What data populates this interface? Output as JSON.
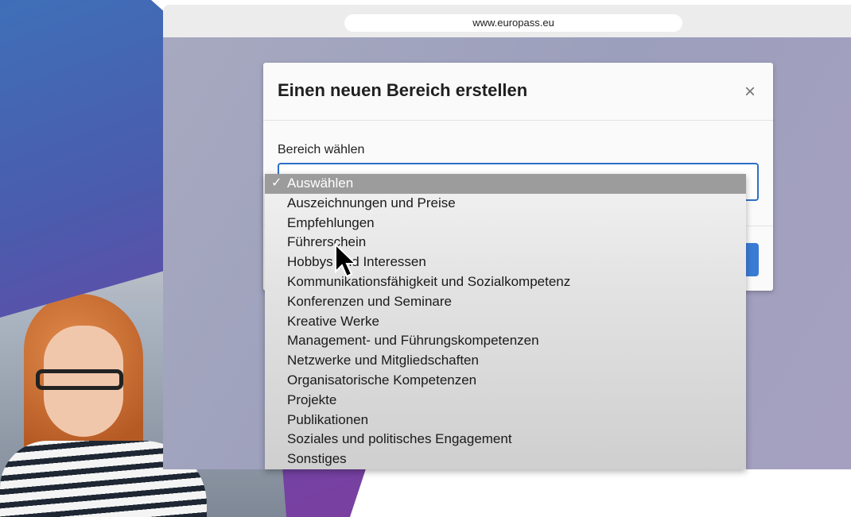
{
  "browser": {
    "url": "www.europass.eu"
  },
  "modal": {
    "title": "Einen neuen Bereich erstellen",
    "close_icon": "close-icon",
    "field_label": "Bereich wählen"
  },
  "dropdown": {
    "selected_check": "✓",
    "options": [
      "Auswählen",
      "Auszeichnungen und Preise",
      "Empfehlungen",
      "Führerschein",
      "Hobbys und Interessen",
      "Kommunikationsfähigkeit und Sozialkompetenz",
      "Konferenzen und Seminare",
      "Kreative Werke",
      "Management- und Führungskompetenzen",
      "Netzwerke und Mitgliedschaften",
      "Organisatorische Kompetenzen",
      "Projekte",
      "Publikationen",
      "Soziales und politisches Engagement",
      "Sonstiges"
    ]
  },
  "colors": {
    "accent": "#3a7bd5",
    "selected_bg": "#9c9c9c"
  }
}
